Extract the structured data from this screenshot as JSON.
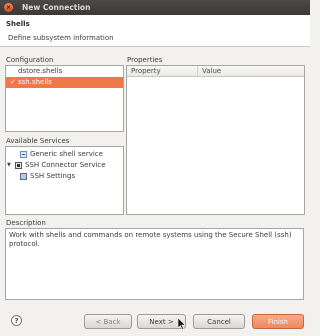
{
  "window": {
    "title": "New Connection",
    "close_glyph": "×"
  },
  "header": {
    "title": "Shells",
    "message": "Define subsystem information"
  },
  "configuration": {
    "label": "Configuration",
    "items": [
      {
        "label": "dstore.shells",
        "selected": false
      },
      {
        "label": "ssh.shells",
        "selected": true,
        "check": "✓"
      }
    ]
  },
  "properties": {
    "label": "Properties",
    "columns": [
      "Property",
      "Value"
    ]
  },
  "services": {
    "label": "Available Services",
    "tree": [
      {
        "label": "Generic shell service",
        "icon": "shell-icon"
      },
      {
        "label": "SSH Connector Service",
        "icon": "connector-icon",
        "expanded": true,
        "expander": "▼"
      },
      {
        "label": "SSH Settings",
        "icon": "settings-icon"
      }
    ]
  },
  "description": {
    "label": "Description",
    "text": "Work with shells and commands on remote systems using the Secure Shell (ssh) protocol."
  },
  "footer": {
    "help_glyph": "?",
    "back": "< Back",
    "next": "Next >",
    "cancel": "Cancel",
    "finish": "Finish"
  },
  "colors": {
    "selection": "#f07746",
    "titlebar": "#3c3b37",
    "finish_button": "#ef8e63"
  }
}
